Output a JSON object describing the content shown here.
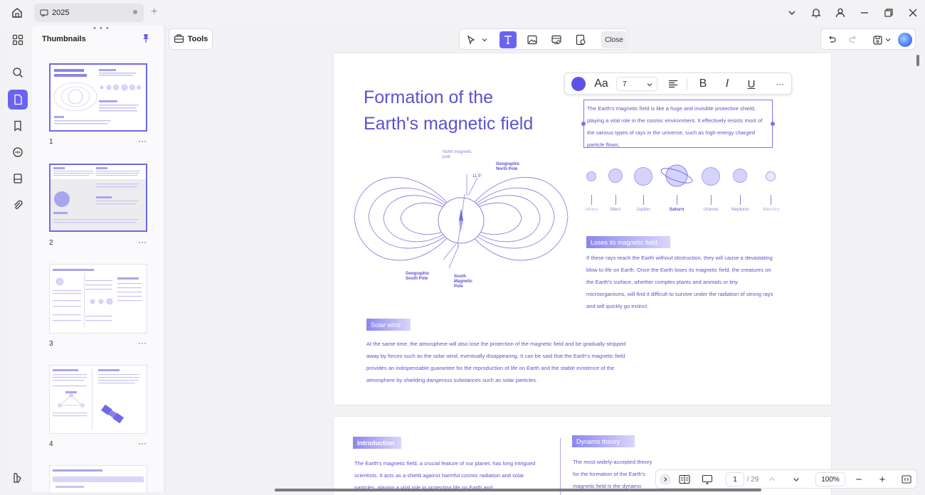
{
  "tab": {
    "title": "2025"
  },
  "sidebar": {
    "title": "Thumbnails",
    "page_numbers": [
      "1",
      "2",
      "3",
      "4"
    ]
  },
  "toolbar": {
    "tools_label": "Tools",
    "close_label": "Close"
  },
  "format_toolbar": {
    "font_size": "7",
    "text_color": "#5b52e8"
  },
  "document": {
    "title_line1": "Formation of the",
    "title_line2": "Earth's magnetic field",
    "selected_text": "The Earth's magnetic field is like a huge and invisible protective shield, playing a vital role in the cosmic environment. It effectively resists most of the various types of rays in the universe, such as high-energy charged particle flows.",
    "diagram_labels": {
      "north_magnetic_pole": "North magnetic pole",
      "geographic_north_pole": "Geographic North Pole",
      "angle": "11.5°",
      "geographic_south_pole": "Geographic South Pole",
      "south_magnetic_pole": "South Magnetic Pole"
    },
    "planets": [
      "Venus",
      "Mars",
      "Jupiter",
      "Saturn",
      "Uranus",
      "Neptune",
      "Mercury"
    ],
    "section_loses": {
      "heading": "Loses its magnetic field",
      "body": "If these rays reach the Earth without obstruction, they will cause a devastating blow to life on Earth. Once the Earth loses its magnetic field, the creatures on the Earth's surface, whether complex plants and animals or tiny microorganisms, will find it difficult to survive under the radiation of strong rays and will quickly go extinct."
    },
    "section_solar": {
      "heading": "Solar wind",
      "body": "At the same time, the atmosphere will also lose the protection of the magnetic field and be gradually stripped away by forces such as the solar wind, eventually disappearing. It can be said that the Earth's magnetic field provides an indispensable guarantee for the reproduction of life on Earth and the stable existence of the atmosphere by shielding dangerous substances such as solar particles."
    },
    "page2": {
      "intro_heading": "Introduction",
      "intro_body": "The Earth's magnetic field, a crucial feature of our planet, has long intrigued scientists. It acts as a shield against harmful cosmic radiation and solar particles, playing a vital role in protecting life on Earth and",
      "dynamo_heading": "Dynamo theory",
      "dynamo_body": "The most widely-accepted theory for the formation of the Earth's magnetic field is the dynamo theory. At the core of the Earth, the Earth's outer core. The outer core"
    }
  },
  "bottom_bar": {
    "current_page": "1",
    "total_pages": "/ 29",
    "zoom": "100%"
  }
}
